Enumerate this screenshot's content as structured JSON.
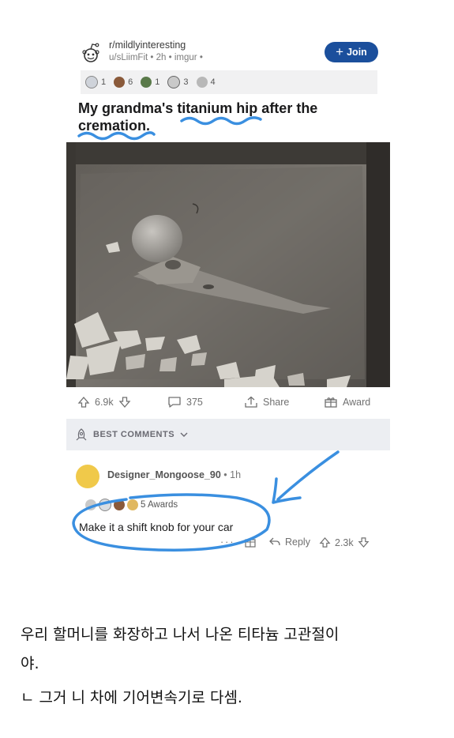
{
  "post": {
    "subreddit": "r/mildlyinteresting",
    "meta_user": "u/sLiimFit",
    "meta_time": "2h",
    "meta_source": "imgur",
    "join_label": "Join",
    "award_counts": [
      "1",
      "6",
      "1",
      "3",
      "4"
    ],
    "title": "My grandma's titanium hip after the cremation.",
    "upvotes": "6.9k",
    "comments": "375",
    "share_label": "Share",
    "award_label": "Award"
  },
  "best_comments_label": "BEST COMMENTS",
  "comment": {
    "username": "Designer_Mongoose_90",
    "time": "1h",
    "awards_label": "5 Awards",
    "text": "Make it a shift knob for your car",
    "reply_label": "Reply",
    "votes": "2.3k"
  },
  "caption": {
    "line1": "우리 할머니를 화장하고 나서 나온 티타늄 고관절이",
    "line2": "야.",
    "line3": "ㄴ 그거 니 차에 기어변속기로 다셈."
  },
  "colors": {
    "join": "#1b4f9c",
    "scribble": "#3a8fe0",
    "best_bg": "#eceef2"
  }
}
